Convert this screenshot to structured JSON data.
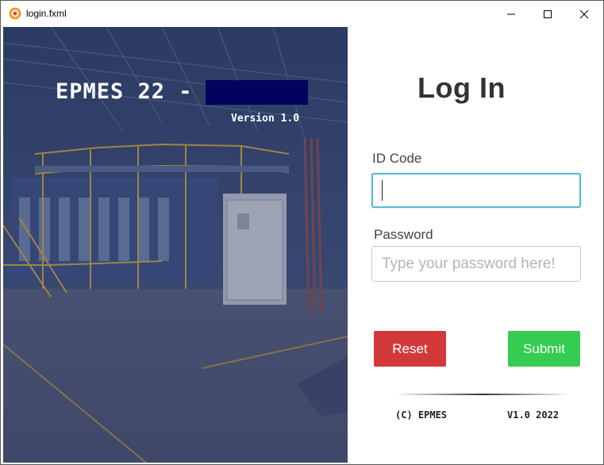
{
  "window": {
    "title": "login.fxml",
    "minimize_icon": "minimize-icon",
    "maximize_icon": "maximize-icon",
    "close_icon": "close-icon"
  },
  "banner": {
    "brand": "EPMES 22 -",
    "version": "Version 1.0"
  },
  "form": {
    "heading": "Log In",
    "id_label": "ID Code",
    "id_value": "",
    "id_placeholder": "",
    "password_label": "Password",
    "password_placeholder": "Type your password here!",
    "reset_label": "Reset",
    "submit_label": "Submit"
  },
  "footer": {
    "copyright": "(C) EPMES",
    "version": "V1.0 2022"
  },
  "colors": {
    "reset": "#d3393b",
    "submit": "#35cc51",
    "redaction": "#03035e",
    "focus": "#5ab7d6"
  }
}
